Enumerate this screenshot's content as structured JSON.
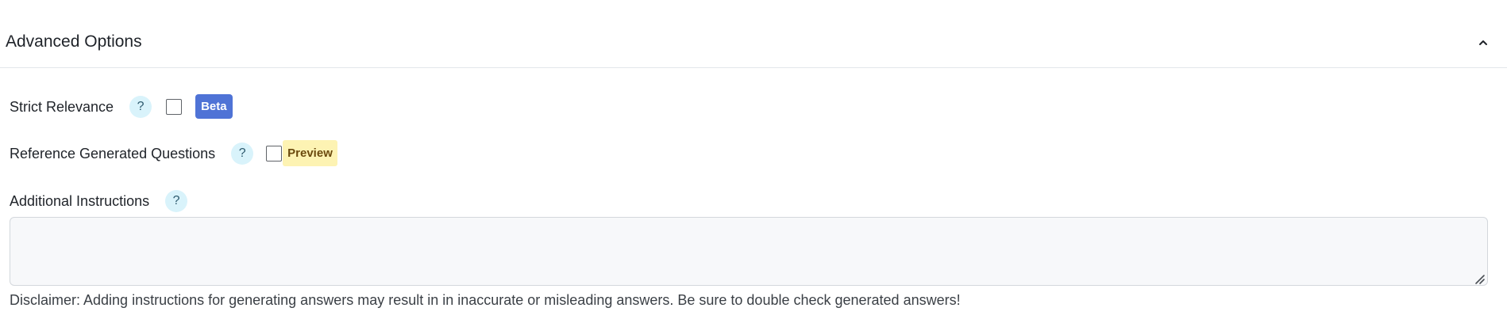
{
  "section": {
    "title": "Advanced Options",
    "collapse_icon": "chevron-up-icon"
  },
  "strict_relevance": {
    "label": "Strict Relevance",
    "help_glyph": "?",
    "checked": false,
    "badge": "Beta",
    "badge_color": "#4f73d6"
  },
  "reference_questions": {
    "label": "Reference Generated Questions",
    "help_glyph": "?",
    "checked": false,
    "badge": "Preview",
    "badge_color": "#fdf3b3"
  },
  "additional_instructions": {
    "label": "Additional Instructions",
    "help_glyph": "?",
    "value": "",
    "placeholder": ""
  },
  "disclaimer": "Disclaimer: Adding instructions for generating answers may result in in inaccurate or misleading answers. Be sure to double check generated answers!"
}
